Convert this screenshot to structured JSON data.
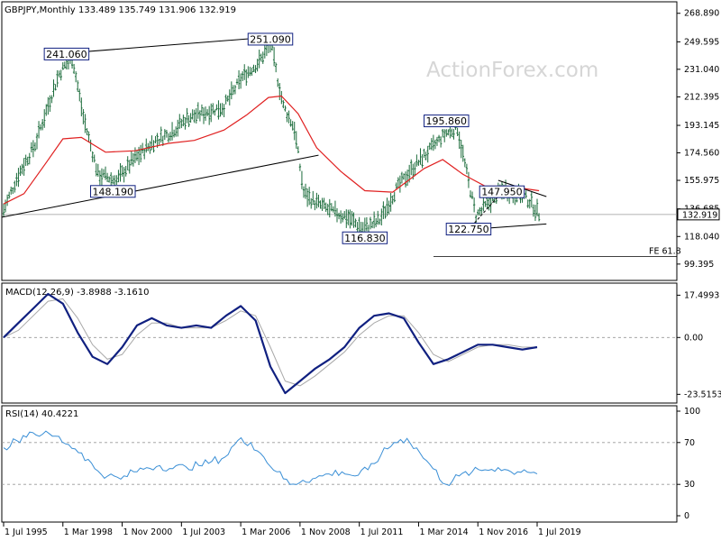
{
  "header": {
    "symbol": "GBPJPY,Monthly",
    "ohlc": "133.489 135.749 131.906 132.919"
  },
  "watermark": "ActionForex.com",
  "colors": {
    "price_bars": "#1a6b3a",
    "ma": "#e02020",
    "trendlines": "#000000",
    "macd": "#102080",
    "macd_signal": "#a8a8a8",
    "rsi": "#3a8fd6",
    "label_border": "#102080",
    "guide": "#999999"
  },
  "chart_data": [
    {
      "type": "line",
      "panel": "price",
      "title": "GBPJPY,Monthly",
      "ylim": [
        92,
        273
      ],
      "y_ticks": [
        "268.890",
        "249.595",
        "231.040",
        "212.395",
        "193.145",
        "174.560",
        "155.975",
        "136.685",
        "118.040",
        "99.395"
      ],
      "last_price_label": "132.919",
      "x_ticks": [
        "1 Jul 1995",
        "1 Mar 1998",
        "1 Nov 2000",
        "1 Jul 2003",
        "1 Mar 2006",
        "1 Nov 2008",
        "1 Jul 2011",
        "1 Mar 2014",
        "1 Nov 2016",
        "1 Jul 2019"
      ],
      "series": [
        {
          "name": "GBPJPY",
          "style": "bars",
          "x": [
            "1995-07",
            "1996-03",
            "1996-12",
            "1997-06",
            "1998-01",
            "1998-08",
            "1999-02",
            "1999-10",
            "2000-08",
            "2001-06",
            "2002-04",
            "2003-02",
            "2003-10",
            "2004-08",
            "2005-06",
            "2006-04",
            "2007-01",
            "2007-07",
            "2008-02",
            "2008-08",
            "2009-01",
            "2009-06",
            "2010-04",
            "2011-01",
            "2011-09",
            "2012-06",
            "2013-03",
            "2013-11",
            "2014-08",
            "2015-06",
            "2015-12",
            "2016-06",
            "2016-10",
            "2017-06",
            "2018-01",
            "2018-10",
            "2019-03",
            "2019-08"
          ],
          "values": [
            136,
            160,
            180,
            203,
            228,
            240,
            199,
            160,
            156,
            171,
            182,
            189,
            198,
            202,
            206,
            226,
            236,
            249,
            206,
            191,
            148,
            142,
            135,
            131,
            123,
            129,
            150,
            163,
            175,
            188,
            191,
            155,
            132,
            142,
            150,
            146,
            142,
            133
          ]
        },
        {
          "name": "MA",
          "style": "line",
          "x": [
            "1995-07",
            "1996-06",
            "1997-06",
            "1998-03",
            "1999-01",
            "2000-02",
            "2001-06",
            "2002-12",
            "2004-02",
            "2005-06",
            "2006-06",
            "2007-06",
            "2008-01",
            "2008-10",
            "2009-08",
            "2010-09",
            "2011-10",
            "2013-01",
            "2014-06",
            "2015-04",
            "2016-03",
            "2017-03",
            "2018-03",
            "2019-08"
          ],
          "values": [
            140,
            147,
            168,
            184,
            185,
            175,
            176,
            181,
            183,
            190,
            200,
            212,
            213,
            201,
            178,
            162,
            149,
            148,
            164,
            170,
            160,
            152,
            152,
            149
          ]
        }
      ],
      "annotations": [
        {
          "text": "241.060",
          "x": "1998-05",
          "y": 241.06
        },
        {
          "text": "251.090",
          "x": "2007-07",
          "y": 251.09
        },
        {
          "text": "148.190",
          "x": "2000-06",
          "y": 148.19
        },
        {
          "text": "195.860",
          "x": "2015-06",
          "y": 195.86
        },
        {
          "text": "116.830",
          "x": "2011-10",
          "y": 116.83
        },
        {
          "text": "122.750",
          "x": "2016-06",
          "y": 122.75
        },
        {
          "text": "147.950",
          "x": "2017-12",
          "y": 147.95
        }
      ],
      "fib_label": "FE 61.8"
    },
    {
      "type": "line",
      "panel": "macd",
      "title": "MACD(12,26,9) -3.8988 -3.1610",
      "ylim": [
        -26,
        21
      ],
      "y_ticks": [
        "17.4993",
        "0.00",
        "-23.5153"
      ],
      "series": [
        {
          "name": "MACD",
          "values": [
            0,
            6,
            12,
            18,
            14,
            2,
            -8,
            -11,
            -4,
            5,
            8,
            5,
            4,
            5,
            4,
            9,
            13,
            7,
            -12,
            -23,
            -18,
            -13,
            -9,
            -4,
            4,
            9,
            10,
            8,
            -2,
            -11,
            -9,
            -6,
            -3,
            -3,
            -4,
            -5,
            -4
          ]
        },
        {
          "name": "Signal",
          "values": [
            0,
            3,
            9,
            15,
            16,
            8,
            -3,
            -9,
            -7,
            1,
            6,
            6,
            4,
            4,
            4,
            7,
            11,
            9,
            -4,
            -18,
            -20,
            -16,
            -11,
            -6,
            1,
            6,
            9,
            9,
            2,
            -7,
            -10,
            -7,
            -4,
            -3,
            -3,
            -4,
            -4
          ]
        }
      ]
    },
    {
      "type": "line",
      "panel": "rsi",
      "title": "RSI(14) 40.4221",
      "ylim": [
        0,
        100
      ],
      "y_ticks": [
        "100",
        "70",
        "30",
        "0"
      ],
      "guides": [
        70,
        30
      ],
      "series": [
        {
          "name": "RSI",
          "values": [
            65,
            72,
            80,
            78,
            76,
            68,
            60,
            45,
            38,
            35,
            42,
            46,
            48,
            45,
            47,
            48,
            52,
            56,
            72,
            70,
            56,
            42,
            30,
            34,
            36,
            40,
            42,
            38,
            44,
            58,
            70,
            74,
            60,
            45,
            30,
            38,
            42,
            44,
            46,
            42,
            44,
            40
          ]
        }
      ]
    }
  ]
}
